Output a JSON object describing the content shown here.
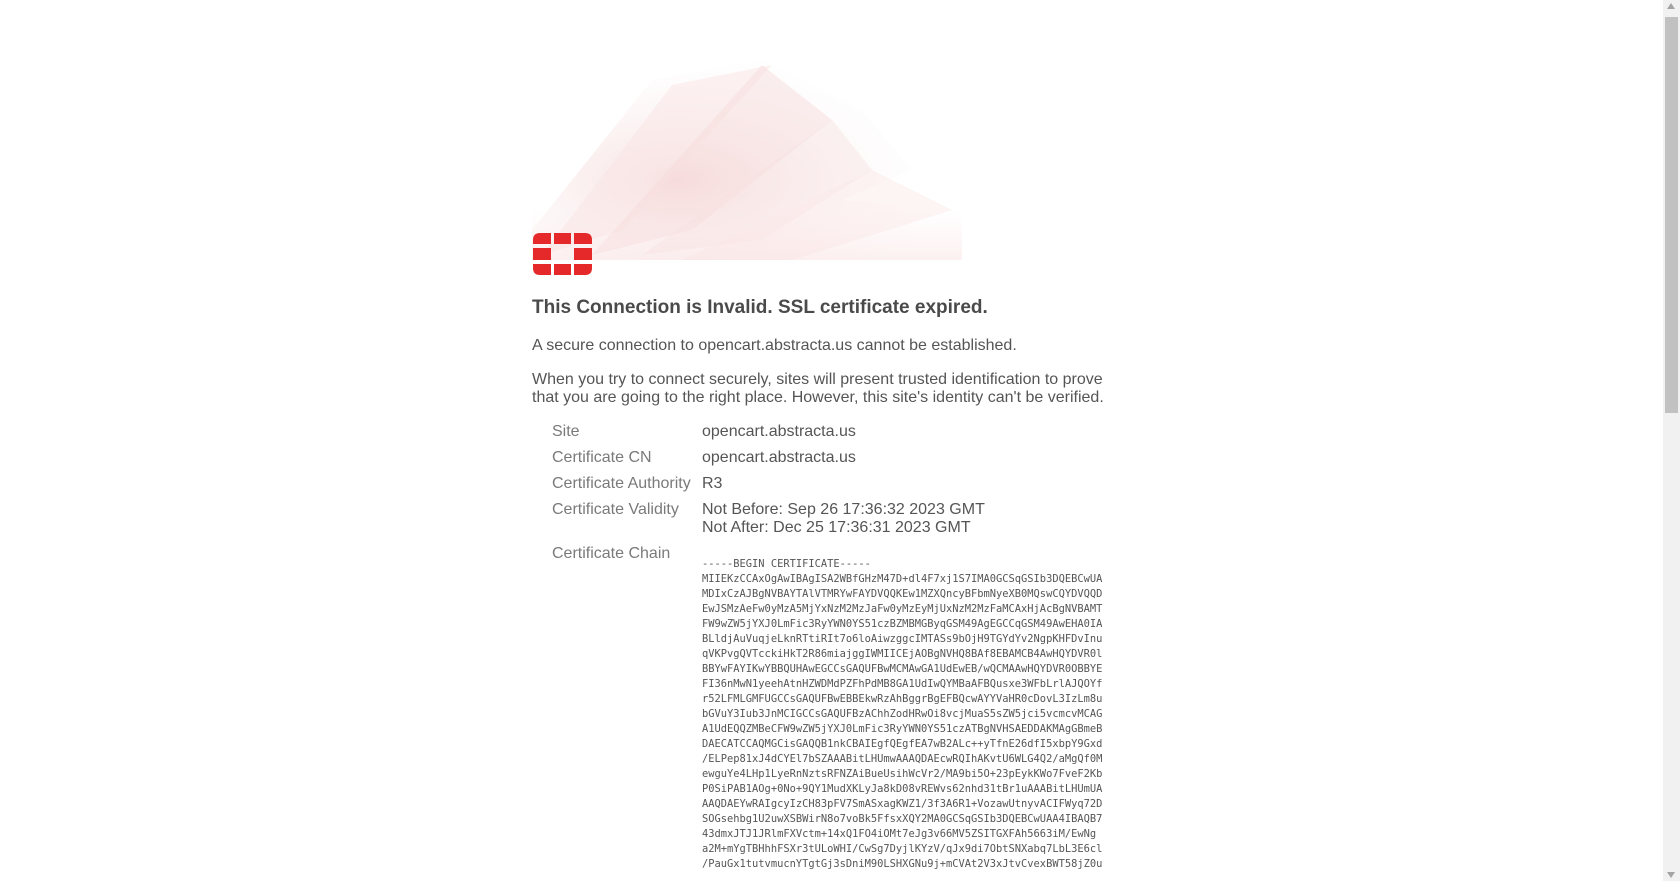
{
  "heading": "This Connection is Invalid. SSL certificate expired.",
  "message": "A secure connection to opencart.abstracta.us cannot be established.",
  "explanation": "When you try to connect securely, sites will present trusted identification to prove that you are going to the right place. However, this site's identity can't be verified.",
  "details": {
    "site_label": "Site",
    "site_value": "opencart.abstracta.us",
    "cn_label": "Certificate CN",
    "cn_value": "opencart.abstracta.us",
    "authority_label": "Certificate Authority",
    "authority_value": "R3",
    "validity_label": "Certificate Validity",
    "not_before": "Not Before: Sep 26 17:36:32 2023 GMT",
    "not_after": "Not After: Dec 25 17:36:31 2023 GMT",
    "chain_label": "Certificate Chain"
  },
  "certificate_chain": "-----BEGIN CERTIFICATE-----\nMIIEKzCCAxOgAwIBAgISA2WBfGHzM47D+dl4F7xj1S7IMA0GCSqGSIb3DQEBCwUA\nMDIxCzAJBgNVBAYTAlVTMRYwFAYDVQQKEw1MZXQncyBFbmNyeXB0MQswCQYDVQQD\nEwJSMzAeFw0yMzA5MjYxNzM2MzJaFw0yMzEyMjUxNzM2MzFaMCAxHjAcBgNVBAMT\nFW9wZW5jYXJ0LmFic3RyYWN0YS51czBZMBMGByqGSM49AgEGCCqGSM49AwEHA0IA\nBLldjAuVuqjeLknRTtiRIt7o6loAiwzggcIMTASs9bOjH9TGYdYv2NgpKHFDvInu\nqVKPvgQVTcckiHkT2R86miajggIWMIICEjAOBgNVHQ8BAf8EBAMCB4AwHQYDVR0l\nBBYwFAYIKwYBBQUHAwEGCCsGAQUFBwMCMAwGA1UdEwEB/wQCMAAwHQYDVR0OBBYE\nFI36nMwN1yeehAtnHZWDMdPZFhPdMB8GA1UdIwQYMBaAFBQusxe3WFbLrlAJQOYf\nr52LFMLGMFUGCCsGAQUFBwEBBEkwRzAhBggrBgEFBQcwAYYVaHR0cDovL3IzLm8u\nbGVuY3Iub3JnMCIGCCsGAQUFBzAChhZodHRwOi8vcjMuaS5sZW5jci5vcmcvMCAG\nA1UdEQQZMBeCFW9wZW5jYXJ0LmFic3RyYWN0YS51czATBgNVHSAEDDAKMAgGBmeB\nDAECATCCAQMGCisGAQQB1nkCBAIEgfQEgfEA7wB2ALc++yTfnE26dfI5xbpY9Gxd\n/ELPep81xJ4dCYEl7bSZAAABitLHUmwAAAQDAEcwRQIhAKvtU6WLG4Q2/aMgQf0M\newguYe4LHp1LyeRnNztsRFNZAiBueUsihWcVr2/MA9bi5O+23pEykKWo7FveF2Kb\nP0SiPAB1AOg+0No+9QY1MudXKLyJa8kD08vREWvs62nhd31tBr1uAAABitLHUmUA\nAAQDAEYwRAIgcyIzCH83pFV7SmASxagKWZ1/3f3A6R1+VozawUtnyvACIFWyq72D\nSOGsehbg1U2uwXSBWirN8o7voBk5FfsxXQY2MA0GCSqGSIb3DQEBCwUAA4IBAQB7\n43dmxJTJ1JRlmFXVctm+14xQ1FO4iOMt7eJg3v66MV5ZSITGXFAh5663iM/EwNg\na2M+mYgTBHhhFSXr3tULoWHI/CwSg7DyjlKYzV/qJx9di7ObtSNXabq7LbL3E6cl\n/PauGx1tutvmucnYTgtGj3sDniM90LSHXGNu9j+mCVAt2V3xJtvCvexBWT58jZ0u"
}
